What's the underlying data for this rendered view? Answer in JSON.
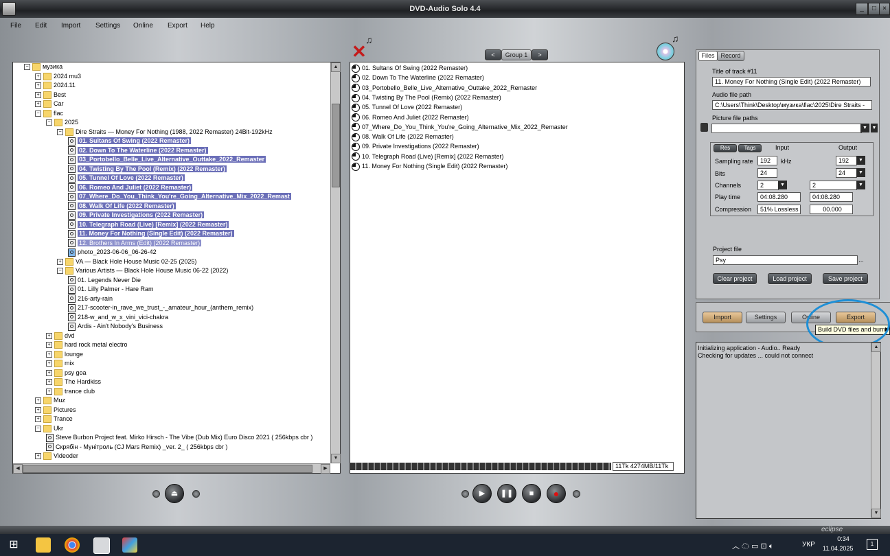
{
  "window": {
    "title": "DVD-Audio Solo 4.4"
  },
  "menu": [
    "File",
    "Edit",
    "Import",
    "Settings",
    "Online",
    "Export",
    "Help"
  ],
  "tree": {
    "rows": [
      {
        "indent": 0,
        "type": "folder-open",
        "label": "музика",
        "sel": ""
      },
      {
        "indent": 1,
        "type": "folder",
        "label": "2024 mu3",
        "sel": ""
      },
      {
        "indent": 1,
        "type": "folder",
        "label": "2024.11",
        "sel": ""
      },
      {
        "indent": 1,
        "type": "folder",
        "label": "Best",
        "sel": ""
      },
      {
        "indent": 1,
        "type": "folder",
        "label": "Car",
        "sel": ""
      },
      {
        "indent": 1,
        "type": "folder-open",
        "label": "flac",
        "sel": ""
      },
      {
        "indent": 2,
        "type": "folder-open",
        "label": "2025",
        "sel": ""
      },
      {
        "indent": 3,
        "type": "folder-open",
        "label": "Dire Straits — Money For Nothing (1988, 2022 Remaster) 24Bit-192kHz",
        "sel": ""
      },
      {
        "indent": 4,
        "type": "file",
        "label": "01. Sultans Of Swing (2022 Remaster)",
        "sel": "sel"
      },
      {
        "indent": 4,
        "type": "file",
        "label": "02. Down To The Waterline (2022 Remaster)",
        "sel": "sel"
      },
      {
        "indent": 4,
        "type": "file",
        "label": "03_Portobello_Belle_Live_Alternative_Outtake_2022_Remaster",
        "sel": "sel"
      },
      {
        "indent": 4,
        "type": "file",
        "label": "04. Twisting By The Pool (Remix) (2022 Remaster)",
        "sel": "sel"
      },
      {
        "indent": 4,
        "type": "file",
        "label": "05. Tunnel Of Love (2022 Remaster)",
        "sel": "sel"
      },
      {
        "indent": 4,
        "type": "file",
        "label": "06. Romeo And Juliet (2022 Remaster)",
        "sel": "sel"
      },
      {
        "indent": 4,
        "type": "file",
        "label": "07_Where_Do_You_Think_You're_Going_Alternative_Mix_2022_Remast",
        "sel": "sel"
      },
      {
        "indent": 4,
        "type": "file",
        "label": "08. Walk Of Life (2022 Remaster)",
        "sel": "sel"
      },
      {
        "indent": 4,
        "type": "file",
        "label": "09. Private Investigations (2022 Remaster)",
        "sel": "sel"
      },
      {
        "indent": 4,
        "type": "file",
        "label": "10. Telegraph Road (Live) [Remix] (2022 Remaster)",
        "sel": "sel"
      },
      {
        "indent": 4,
        "type": "file",
        "label": "11. Money For Nothing (Single Edit) (2022 Remaster)",
        "sel": "sel"
      },
      {
        "indent": 4,
        "type": "file",
        "label": "12. Brothers In Arms (Edit) (2022 Remaster)",
        "sel": "sel-light"
      },
      {
        "indent": 4,
        "type": "image",
        "label": "photo_2023-06-06_06-26-42",
        "sel": ""
      },
      {
        "indent": 3,
        "type": "folder",
        "label": "VA — Black Hole House Music 02-25 (2025)",
        "sel": ""
      },
      {
        "indent": 3,
        "type": "folder-open",
        "label": "Various Artists — Black Hole House Music 06-22 (2022)",
        "sel": ""
      },
      {
        "indent": 4,
        "type": "file",
        "label": "01. Legends Never Die",
        "sel": ""
      },
      {
        "indent": 4,
        "type": "file",
        "label": "01. Lilly Palmer - Hare Ram",
        "sel": ""
      },
      {
        "indent": 4,
        "type": "file",
        "label": "216-arty-rain",
        "sel": ""
      },
      {
        "indent": 4,
        "type": "file",
        "label": "217-scooter-in_rave_we_trust_-_amateur_hour_(anthem_remix)",
        "sel": ""
      },
      {
        "indent": 4,
        "type": "file",
        "label": "218-w_and_w_x_vini_vici-chakra",
        "sel": ""
      },
      {
        "indent": 4,
        "type": "file",
        "label": "Ardis - Ain't Nobody's Business",
        "sel": ""
      },
      {
        "indent": 2,
        "type": "folder",
        "label": "dvd",
        "sel": ""
      },
      {
        "indent": 2,
        "type": "folder",
        "label": "hard rock metal electro",
        "sel": ""
      },
      {
        "indent": 2,
        "type": "folder",
        "label": "lounge",
        "sel": ""
      },
      {
        "indent": 2,
        "type": "folder",
        "label": "mix",
        "sel": ""
      },
      {
        "indent": 2,
        "type": "folder",
        "label": "psy goa",
        "sel": ""
      },
      {
        "indent": 2,
        "type": "folder",
        "label": "The Hardkiss",
        "sel": ""
      },
      {
        "indent": 2,
        "type": "folder",
        "label": "trance club",
        "sel": ""
      },
      {
        "indent": 1,
        "type": "folder",
        "label": "Muz",
        "sel": ""
      },
      {
        "indent": 1,
        "type": "folder",
        "label": "Pictures",
        "sel": ""
      },
      {
        "indent": 1,
        "type": "folder",
        "label": "Trance",
        "sel": ""
      },
      {
        "indent": 1,
        "type": "folder-open",
        "label": "Ukr",
        "sel": ""
      },
      {
        "indent": 2,
        "type": "file",
        "label": "Steve Burbon Project feat. Mirko Hirsch - The Vibe (Dub Mix) Euro Disco 2021 ( 256kbps cbr )",
        "sel": ""
      },
      {
        "indent": 2,
        "type": "file",
        "label": "Скрябін - Мунітроль (CJ Mars Remix) _ver. 2_ ( 256kbps cbr )",
        "sel": ""
      },
      {
        "indent": 1,
        "type": "folder",
        "label": "Videoder",
        "sel": ""
      }
    ]
  },
  "group_nav": {
    "prev": "<",
    "label": "Group 1",
    "next": ">"
  },
  "tracks": [
    "01. Sultans Of Swing (2022 Remaster)",
    "02. Down To The Waterline (2022 Remaster)",
    "03_Portobello_Belle_Live_Alternative_Outtake_2022_Remaster",
    "04. Twisting By The Pool (Remix) (2022 Remaster)",
    "05. Tunnel Of Love (2022 Remaster)",
    "06. Romeo And Juliet (2022 Remaster)",
    "07_Where_Do_You_Think_You're_Going_Alternative_Mix_2022_Remaster",
    "08. Walk Of Life (2022 Remaster)",
    "09. Private Investigations (2022 Remaster)",
    "10. Telegraph Road (Live) [Remix] (2022 Remaster)",
    "11. Money For Nothing (Single Edit) (2022 Remaster)"
  ],
  "capacity_label": "11Tk 4274MB/11Tk",
  "props": {
    "tab_files": "Files",
    "tab_record": "Record",
    "title_label": "Title of track #11",
    "title_value": "11. Money For Nothing (Single Edit) (2022 Remaster)",
    "audio_label": "Audio file path",
    "audio_value": "C:\\Users\\Think\\Desktop\\музика\\flac\\2025\\Dire Straits -",
    "picture_label": "Picture file paths",
    "picture_value": "",
    "res_btn": "Res",
    "tags_btn": "Tags",
    "input_hdr": "Input",
    "output_hdr": "Output",
    "sr_label": "Sampling rate",
    "sr_in": "192",
    "sr_unit": "kHz",
    "sr_out": "192",
    "bits_label": "Bits",
    "bits_in": "24",
    "bits_out": "24",
    "ch_label": "Channels",
    "ch_in": "2",
    "ch_out": "2",
    "pt_label": "Play time",
    "pt_in": "04:08.280",
    "pt_out": "04:08.280",
    "comp_label": "Compression",
    "comp_in": "51% Lossless",
    "comp_out": "00.000",
    "project_label": "Project file",
    "project_value": "Psy",
    "project_browse": "...",
    "clear": "Clear project",
    "load": "Load project",
    "save": "Save project"
  },
  "actions": {
    "import": "Import",
    "settings": "Settings",
    "online": "Online",
    "export": "Export",
    "tooltip": "Build DVD files and burn"
  },
  "log": [
    "Initializing application - Audio.. Ready",
    "Checking for updates ... could not connect"
  ],
  "brand": "eclipse",
  "taskbar": {
    "lang": "УКР",
    "time": "0:34",
    "date": "11.04.2025"
  }
}
